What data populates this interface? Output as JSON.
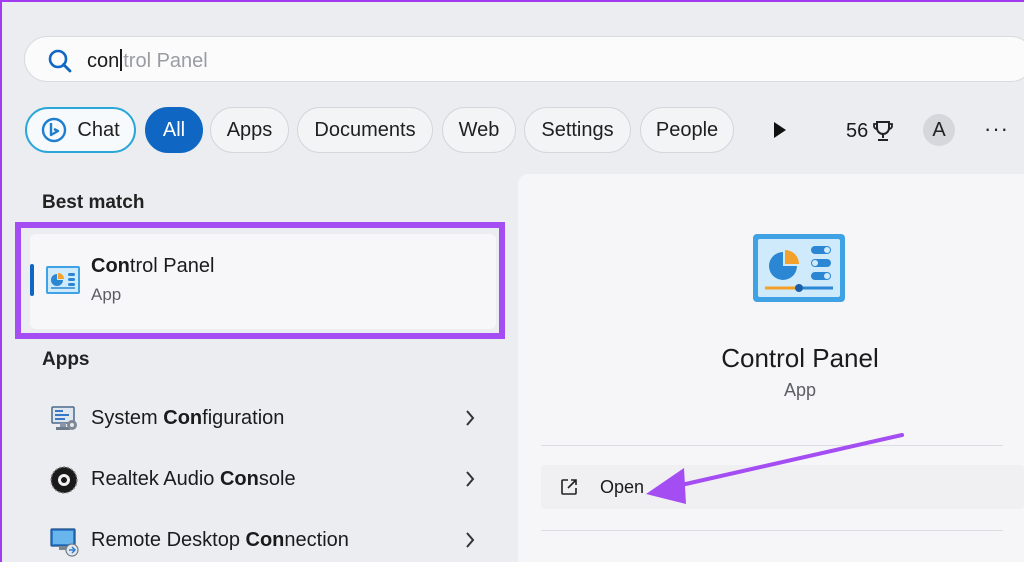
{
  "search": {
    "typed": "con",
    "suggestion": "trol Panel"
  },
  "filters": {
    "chat": "Chat",
    "all": "All",
    "apps": "Apps",
    "documents": "Documents",
    "web": "Web",
    "settings": "Settings",
    "people": "People"
  },
  "rewards": {
    "points": "56"
  },
  "account": {
    "initial": "A"
  },
  "more_label": "···",
  "best_match": {
    "heading": "Best match",
    "name_bold": "Con",
    "name_rest": "trol Panel",
    "type": "App"
  },
  "apps": {
    "heading": "Apps",
    "items": [
      {
        "before": "System ",
        "bold": "Con",
        "after": "figuration"
      },
      {
        "before": "Realtek Audio ",
        "bold": "Con",
        "after": "sole"
      },
      {
        "before": "Remote Desktop ",
        "bold": "Con",
        "after": "nection"
      }
    ]
  },
  "detail": {
    "name": "Control Panel",
    "type": "App",
    "open_label": "Open"
  },
  "colors": {
    "accent": "#0f67c3",
    "highlight": "#a44df2",
    "chat_border": "#2aa7d8"
  }
}
